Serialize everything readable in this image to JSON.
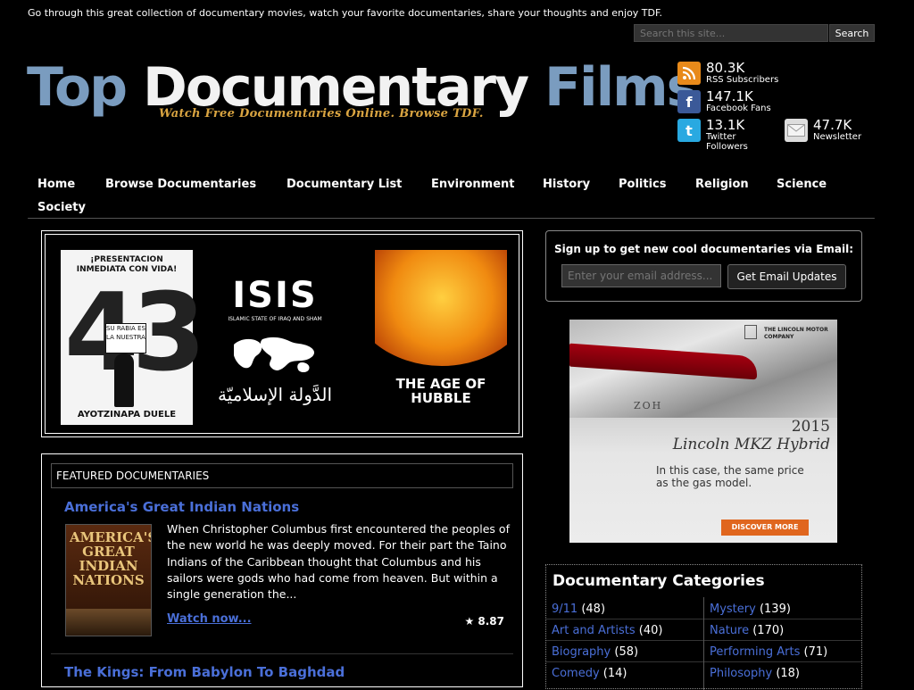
{
  "header": {
    "tagline": "Go through this great collection of documentary movies, watch your favorite documentaries, share your thoughts and enjoy TDF.",
    "search_placeholder": "Search this site...",
    "search_button": "Search",
    "logo_word1": "Top",
    "logo_word2": "Documentary",
    "logo_word3": "Films",
    "logo_sub": "Watch Free Documentaries Online. Browse TDF."
  },
  "stats": [
    {
      "icon": "rss-icon",
      "count": "80.3K",
      "label": "RSS Subscribers"
    },
    {
      "icon": "facebook-icon",
      "count": "147.1K",
      "label": "Facebook Fans"
    },
    {
      "icon": "twitter-icon",
      "count": "13.1K",
      "label": "Twitter Followers"
    },
    {
      "icon": "mail-icon",
      "count": "47.7K",
      "label": "Newsletter"
    }
  ],
  "nav": [
    "Home",
    "Browse Documentaries",
    "Documentary List",
    "Environment",
    "History",
    "Politics",
    "Religion",
    "Science",
    "Society"
  ],
  "slider": {
    "poster1_top": "¡PRESENTACION INMEDIATA CON VIDA!",
    "poster1_sign": "SU RABIA ES LA NUESTRA",
    "poster1_num": "43",
    "poster1_bottom": "AYOTZINAPA DUELE",
    "poster2_title": "ISIS",
    "poster2_sub": "ISLAMIC STATE OF IRAQ AND SHAM",
    "poster2_arabic": "الدَّولة الإسلاميّة",
    "poster3_title": "THE AGE OF HUBBLE"
  },
  "signup": {
    "title": "Sign up to get new cool documentaries via Email:",
    "placeholder": "Enter your email address...",
    "button": "Get Email Updates"
  },
  "ad": {
    "brand": "THE LINCOLN MOTOR COMPANY",
    "badge": "ZOH",
    "year": "2015",
    "model": "Lincoln MKZ Hybrid",
    "copy": "In this case, the same price as the gas model.",
    "cta": "DISCOVER MORE"
  },
  "featured": {
    "heading": "FEATURED DOCUMENTARIES",
    "items": [
      {
        "title": "America's Great Indian Nations",
        "poster_text": "AMERICA'S GREAT INDIAN NATIONS",
        "description": "When Christopher Columbus first encountered the peoples of the new world he was deeply moved. For their part the Taino Indians of the Caribbean thought that Columbus and his sailors were gods who had come from heaven. But within a single generation the...",
        "watch": "Watch now...",
        "rating": "★ 8.87"
      },
      {
        "title": "The Kings: From Babylon To Baghdad"
      }
    ]
  },
  "categories": {
    "title": "Documentary Categories",
    "items": [
      {
        "name": "9/11",
        "count": "(48)"
      },
      {
        "name": "Mystery",
        "count": "(139)"
      },
      {
        "name": "Art and Artists",
        "count": "(40)"
      },
      {
        "name": "Nature",
        "count": "(170)"
      },
      {
        "name": "Biography",
        "count": "(58)"
      },
      {
        "name": "Performing Arts",
        "count": "(71)"
      },
      {
        "name": "Comedy",
        "count": "(14)"
      },
      {
        "name": "Philosophy",
        "count": "(18)"
      }
    ]
  },
  "colors": {
    "link": "#4a6fd8",
    "logo_blue": "#7a9cbf",
    "logo_sub": "#d9a441"
  }
}
